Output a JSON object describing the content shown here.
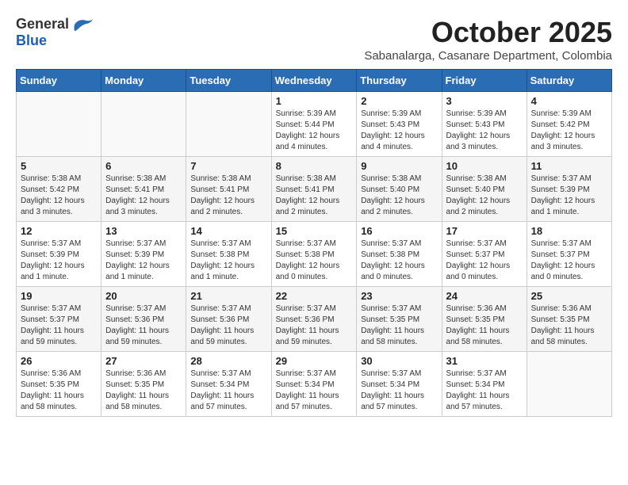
{
  "logo": {
    "general": "General",
    "blue": "Blue"
  },
  "title": "October 2025",
  "subtitle": "Sabanalarga, Casanare Department, Colombia",
  "days_of_week": [
    "Sunday",
    "Monday",
    "Tuesday",
    "Wednesday",
    "Thursday",
    "Friday",
    "Saturday"
  ],
  "weeks": [
    [
      {
        "day": "",
        "info": ""
      },
      {
        "day": "",
        "info": ""
      },
      {
        "day": "",
        "info": ""
      },
      {
        "day": "1",
        "info": "Sunrise: 5:39 AM\nSunset: 5:44 PM\nDaylight: 12 hours\nand 4 minutes."
      },
      {
        "day": "2",
        "info": "Sunrise: 5:39 AM\nSunset: 5:43 PM\nDaylight: 12 hours\nand 4 minutes."
      },
      {
        "day": "3",
        "info": "Sunrise: 5:39 AM\nSunset: 5:43 PM\nDaylight: 12 hours\nand 3 minutes."
      },
      {
        "day": "4",
        "info": "Sunrise: 5:39 AM\nSunset: 5:42 PM\nDaylight: 12 hours\nand 3 minutes."
      }
    ],
    [
      {
        "day": "5",
        "info": "Sunrise: 5:38 AM\nSunset: 5:42 PM\nDaylight: 12 hours\nand 3 minutes."
      },
      {
        "day": "6",
        "info": "Sunrise: 5:38 AM\nSunset: 5:41 PM\nDaylight: 12 hours\nand 3 minutes."
      },
      {
        "day": "7",
        "info": "Sunrise: 5:38 AM\nSunset: 5:41 PM\nDaylight: 12 hours\nand 2 minutes."
      },
      {
        "day": "8",
        "info": "Sunrise: 5:38 AM\nSunset: 5:41 PM\nDaylight: 12 hours\nand 2 minutes."
      },
      {
        "day": "9",
        "info": "Sunrise: 5:38 AM\nSunset: 5:40 PM\nDaylight: 12 hours\nand 2 minutes."
      },
      {
        "day": "10",
        "info": "Sunrise: 5:38 AM\nSunset: 5:40 PM\nDaylight: 12 hours\nand 2 minutes."
      },
      {
        "day": "11",
        "info": "Sunrise: 5:37 AM\nSunset: 5:39 PM\nDaylight: 12 hours\nand 1 minute."
      }
    ],
    [
      {
        "day": "12",
        "info": "Sunrise: 5:37 AM\nSunset: 5:39 PM\nDaylight: 12 hours\nand 1 minute."
      },
      {
        "day": "13",
        "info": "Sunrise: 5:37 AM\nSunset: 5:39 PM\nDaylight: 12 hours\nand 1 minute."
      },
      {
        "day": "14",
        "info": "Sunrise: 5:37 AM\nSunset: 5:38 PM\nDaylight: 12 hours\nand 1 minute."
      },
      {
        "day": "15",
        "info": "Sunrise: 5:37 AM\nSunset: 5:38 PM\nDaylight: 12 hours\nand 0 minutes."
      },
      {
        "day": "16",
        "info": "Sunrise: 5:37 AM\nSunset: 5:38 PM\nDaylight: 12 hours\nand 0 minutes."
      },
      {
        "day": "17",
        "info": "Sunrise: 5:37 AM\nSunset: 5:37 PM\nDaylight: 12 hours\nand 0 minutes."
      },
      {
        "day": "18",
        "info": "Sunrise: 5:37 AM\nSunset: 5:37 PM\nDaylight: 12 hours\nand 0 minutes."
      }
    ],
    [
      {
        "day": "19",
        "info": "Sunrise: 5:37 AM\nSunset: 5:37 PM\nDaylight: 11 hours\nand 59 minutes."
      },
      {
        "day": "20",
        "info": "Sunrise: 5:37 AM\nSunset: 5:36 PM\nDaylight: 11 hours\nand 59 minutes."
      },
      {
        "day": "21",
        "info": "Sunrise: 5:37 AM\nSunset: 5:36 PM\nDaylight: 11 hours\nand 59 minutes."
      },
      {
        "day": "22",
        "info": "Sunrise: 5:37 AM\nSunset: 5:36 PM\nDaylight: 11 hours\nand 59 minutes."
      },
      {
        "day": "23",
        "info": "Sunrise: 5:37 AM\nSunset: 5:35 PM\nDaylight: 11 hours\nand 58 minutes."
      },
      {
        "day": "24",
        "info": "Sunrise: 5:36 AM\nSunset: 5:35 PM\nDaylight: 11 hours\nand 58 minutes."
      },
      {
        "day": "25",
        "info": "Sunrise: 5:36 AM\nSunset: 5:35 PM\nDaylight: 11 hours\nand 58 minutes."
      }
    ],
    [
      {
        "day": "26",
        "info": "Sunrise: 5:36 AM\nSunset: 5:35 PM\nDaylight: 11 hours\nand 58 minutes."
      },
      {
        "day": "27",
        "info": "Sunrise: 5:36 AM\nSunset: 5:35 PM\nDaylight: 11 hours\nand 58 minutes."
      },
      {
        "day": "28",
        "info": "Sunrise: 5:37 AM\nSunset: 5:34 PM\nDaylight: 11 hours\nand 57 minutes."
      },
      {
        "day": "29",
        "info": "Sunrise: 5:37 AM\nSunset: 5:34 PM\nDaylight: 11 hours\nand 57 minutes."
      },
      {
        "day": "30",
        "info": "Sunrise: 5:37 AM\nSunset: 5:34 PM\nDaylight: 11 hours\nand 57 minutes."
      },
      {
        "day": "31",
        "info": "Sunrise: 5:37 AM\nSunset: 5:34 PM\nDaylight: 11 hours\nand 57 minutes."
      },
      {
        "day": "",
        "info": ""
      }
    ]
  ]
}
